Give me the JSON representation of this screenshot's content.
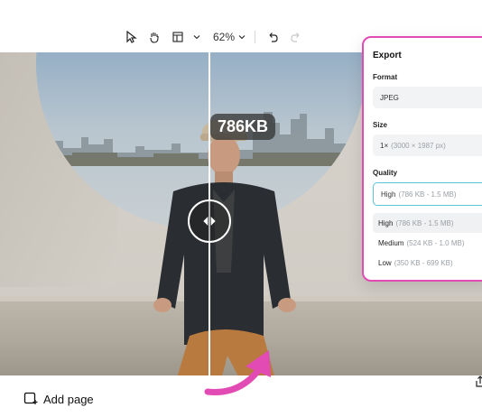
{
  "toolbar": {
    "zoom": "62%"
  },
  "canvas": {
    "size_badge": "786KB"
  },
  "export_panel": {
    "title": "Export",
    "format_label": "Format",
    "format_value": "JPEG",
    "size_label": "Size",
    "size_value": "1×",
    "size_dims": "(3000 × 1987 px)",
    "quality_label": "Quality",
    "quality_selected": "High",
    "quality_selected_range": "(786 KB - 1.5 MB)",
    "quality_options": [
      {
        "name": "High",
        "range": "(786 KB - 1.5 MB)"
      },
      {
        "name": "Medium",
        "range": "(524 KB - 1.0 MB)"
      },
      {
        "name": "Low",
        "range": "(350 KB - 699 KB)"
      }
    ]
  },
  "bottom": {
    "add_page": "Add page"
  },
  "colors": {
    "accent_pink": "#e24ab4",
    "focus_teal": "#59c4d4"
  }
}
